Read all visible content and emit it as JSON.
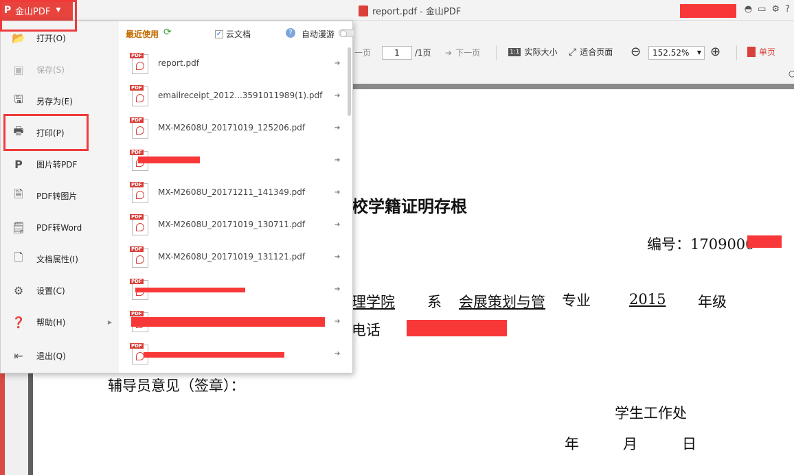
{
  "title_bar": {
    "app_button_label": "金山PDF",
    "window_title": "report.pdf - 金山PDF"
  },
  "toolbar": {
    "prev_page": "一页",
    "page_value": "1",
    "page_total": "/1页",
    "next_page": "下一页",
    "actual_size": "实际大小",
    "fit_page": "适合页面",
    "zoom_value": "152.52%",
    "single_page": "单页"
  },
  "menu": {
    "items": [
      {
        "label": "打开(O)",
        "icon": "folder-open-icon",
        "enabled": true
      },
      {
        "label": "保存(S)",
        "icon": "save-icon",
        "enabled": false
      },
      {
        "label": "另存为(E)",
        "icon": "save-as-icon",
        "enabled": true
      },
      {
        "label": "打印(P)",
        "icon": "printer-icon",
        "enabled": true
      },
      {
        "label": "图片转PDF",
        "icon": "image-to-pdf-icon",
        "enabled": true
      },
      {
        "label": "PDF转图片",
        "icon": "pdf-to-image-icon",
        "enabled": true
      },
      {
        "label": "PDF转Word",
        "icon": "pdf-to-word-icon",
        "enabled": true
      },
      {
        "label": "文档属性(I)",
        "icon": "document-properties-icon",
        "enabled": true
      },
      {
        "label": "设置(C)",
        "icon": "gear-icon",
        "enabled": true
      },
      {
        "label": "帮助(H)",
        "icon": "help-icon",
        "enabled": true
      },
      {
        "label": "退出(Q)",
        "icon": "exit-icon",
        "enabled": true
      }
    ]
  },
  "recent": {
    "title": "最近使用",
    "cloud_docs": "云文档",
    "auto_roam": "自动漫游",
    "files": [
      {
        "name": "report.pdf",
        "redacted": false
      },
      {
        "name": "emailreceipt_2012...3591011989(1).pdf",
        "redacted": false
      },
      {
        "name": "MX-M2608U_20171019_125206.pdf",
        "redacted": false
      },
      {
        "name": "",
        "redacted": true
      },
      {
        "name": "MX-M2608U_20171211_141349.pdf",
        "redacted": false
      },
      {
        "name": "MX-M2608U_20171019_130711.pdf",
        "redacted": false
      },
      {
        "name": "MX-M2608U_20171019_131121.pdf",
        "redacted": false
      },
      {
        "name": "",
        "redacted": true
      },
      {
        "name": "",
        "redacted": true
      },
      {
        "name": "",
        "redacted": true
      }
    ]
  },
  "document": {
    "heading": "校学籍证明存根",
    "serial_label": "编号：1709000",
    "line_dept_a": "理学院",
    "line_dept_sep": "系",
    "line_major": "会展策划与管",
    "line_major_suffix": "专业",
    "line_year": "2015",
    "line_grade": "年级",
    "phone_label": "电话",
    "counselor": "辅导员意见（签章）：",
    "office": "学生工作处",
    "date_year": "年",
    "date_month": "月",
    "date_day": "日"
  }
}
